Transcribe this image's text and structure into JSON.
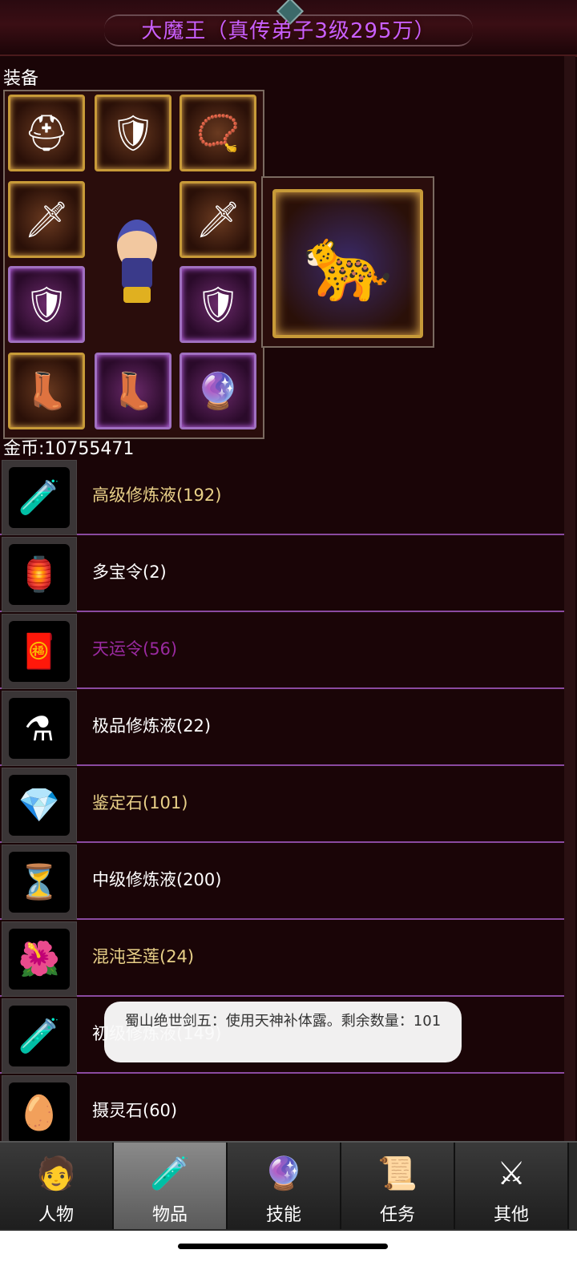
{
  "title": "大魔王（真传弟子3级295万）",
  "equipment": {
    "label": "装备",
    "slots": [
      {
        "icon": "helmet-icon",
        "glyph": "⛑"
      },
      {
        "icon": "armor-icon",
        "glyph": "🛡"
      },
      {
        "icon": "necklace-icon",
        "glyph": "📿"
      },
      {
        "icon": "sword-icon",
        "glyph": "🗡"
      },
      {
        "icon": "sword-icon",
        "glyph": "🗡"
      },
      {
        "icon": "shield-icon",
        "glyph": "🛡"
      },
      {
        "icon": "shield-icon",
        "glyph": "🛡"
      },
      {
        "icon": "boot-icon",
        "glyph": "👢"
      },
      {
        "icon": "boot-icon",
        "glyph": "👢"
      },
      {
        "icon": "gem-icon",
        "glyph": "🔮"
      }
    ],
    "pet_icon": "pet-panther-icon"
  },
  "gold": {
    "text": "金币:10755471"
  },
  "items": [
    {
      "name": "高级修炼液(192)",
      "color": "#e8d088",
      "icon": "blue-potion-icon",
      "glyph": "🧪"
    },
    {
      "name": "多宝令(2)",
      "color": "#ffffff",
      "icon": "token-icon",
      "glyph": "🏮"
    },
    {
      "name": "天运令(56)",
      "color": "#9a2aa0",
      "icon": "charm-icon",
      "glyph": "🧧"
    },
    {
      "name": "极品修炼液(22)",
      "color": "#ffffff",
      "icon": "flask-icon",
      "glyph": "⚗"
    },
    {
      "name": "鉴定石(101)",
      "color": "#e8d088",
      "icon": "rainbow-stone-icon",
      "glyph": "💎"
    },
    {
      "name": "中级修炼液(200)",
      "color": "#ffffff",
      "icon": "hourglass-potion-icon",
      "glyph": "⏳"
    },
    {
      "name": "混沌圣莲(24)",
      "color": "#e8d088",
      "icon": "lotus-icon",
      "glyph": "🌺"
    },
    {
      "name": "初级修炼液(149)",
      "color": "#ffffff",
      "icon": "vial-icon",
      "glyph": "🧪"
    },
    {
      "name": "摄灵石(60)",
      "color": "#ffffff",
      "icon": "spirit-egg-icon",
      "glyph": "🥚"
    }
  ],
  "toast": "蜀山绝世剑五：使用天神补体露。剩余数量：101",
  "tabs": [
    {
      "label": "人物",
      "icon": "character-icon",
      "glyph": "🧑"
    },
    {
      "label": "物品",
      "icon": "items-potion-icon",
      "glyph": "🧪",
      "active": true
    },
    {
      "label": "技能",
      "icon": "skill-orb-icon",
      "glyph": "🔮"
    },
    {
      "label": "任务",
      "icon": "quest-icon",
      "glyph": "📜"
    },
    {
      "label": "其他",
      "icon": "other-icon",
      "glyph": "⚔"
    }
  ]
}
